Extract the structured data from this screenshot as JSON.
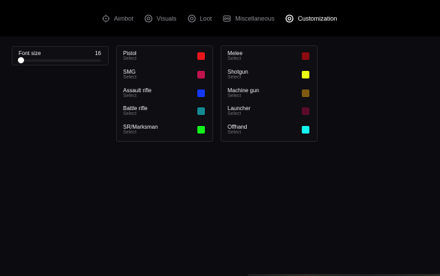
{
  "nav": {
    "tabs": [
      {
        "label": "Aimbot",
        "icon": "crosshair-icon",
        "active": false
      },
      {
        "label": "Visuals",
        "icon": "eye-icon",
        "active": false
      },
      {
        "label": "Loot",
        "icon": "eye-icon",
        "active": false
      },
      {
        "label": "Miscellaneous",
        "icon": "gamepad-icon",
        "active": false
      },
      {
        "label": "Customization",
        "icon": "eye-icon",
        "active": true
      }
    ]
  },
  "font_setting": {
    "label": "Font size",
    "value": "16",
    "slider_fraction": 0.0
  },
  "weapon_colors": {
    "left": [
      {
        "name": "Pistol",
        "action": "Select",
        "color": "#e8161b"
      },
      {
        "name": "SMG",
        "action": "Select",
        "color": "#c0134b"
      },
      {
        "name": "Assault rifle",
        "action": "Select",
        "color": "#1437f5"
      },
      {
        "name": "Battle rifle",
        "action": "Select",
        "color": "#148a93"
      },
      {
        "name": "SR/Marksman",
        "action": "Select",
        "color": "#12f21c"
      }
    ],
    "right": [
      {
        "name": "Melee",
        "action": "Select",
        "color": "#8a0b10"
      },
      {
        "name": "Shotgun",
        "action": "Select",
        "color": "#e8ff14"
      },
      {
        "name": "Machine gun",
        "action": "Select",
        "color": "#7d5a10"
      },
      {
        "name": "Launcher",
        "action": "Select",
        "color": "#5a0a2a"
      },
      {
        "name": "Offhand",
        "action": "Select",
        "color": "#14f5f0"
      }
    ]
  }
}
